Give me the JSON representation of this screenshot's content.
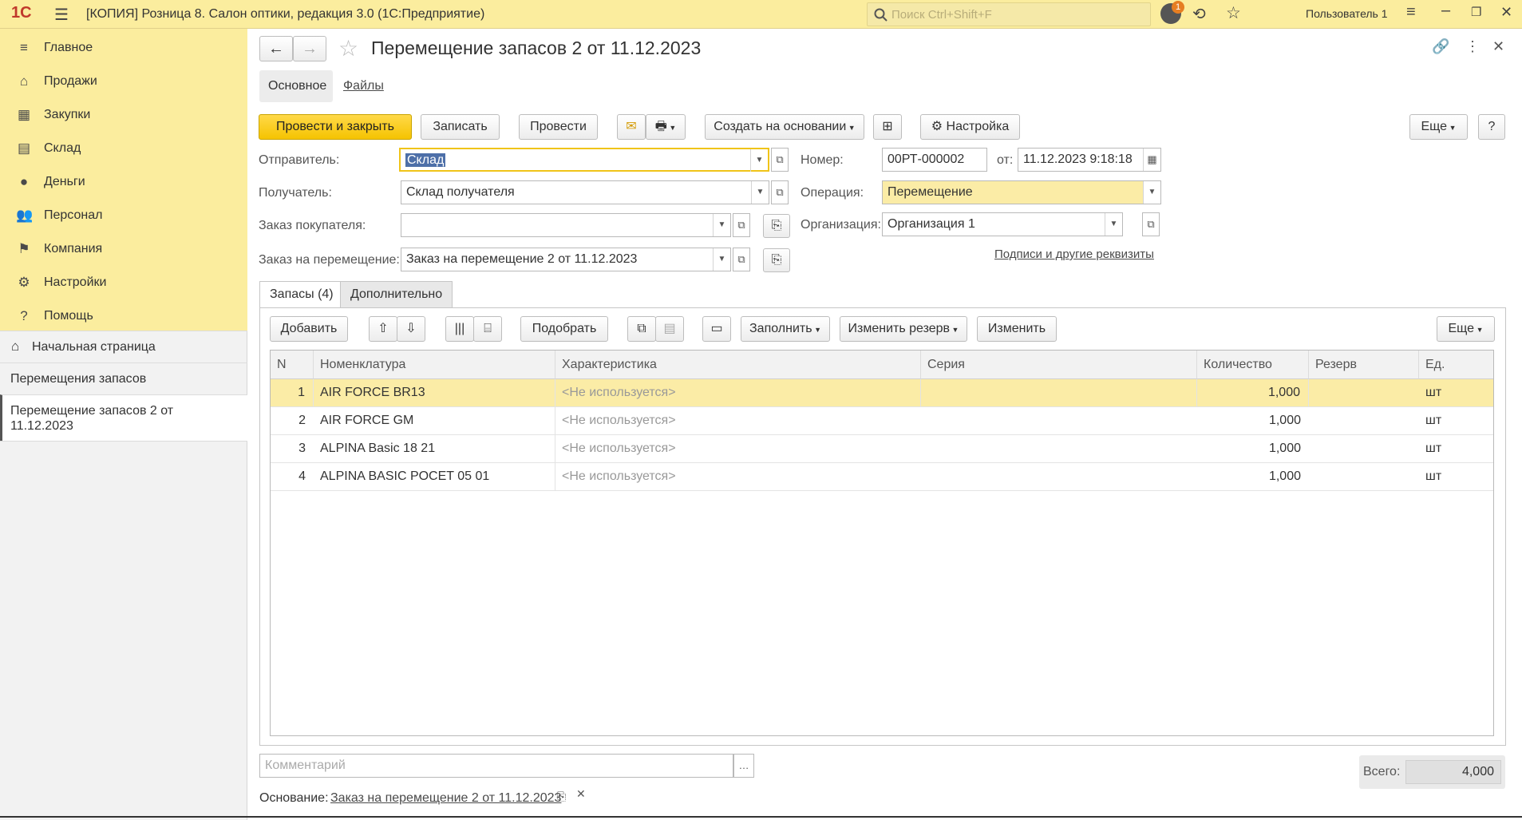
{
  "titlebar": {
    "logo": "1С",
    "title": "[КОПИЯ] Розница 8. Салон оптики, редакция 3.0  (1С:Предприятие)",
    "search_placeholder": "Поиск Ctrl+Shift+F",
    "notification_count": "1",
    "user": "Пользователь 1"
  },
  "sidebar": {
    "sections": [
      {
        "label": "Главное",
        "icon": "menu-icon"
      },
      {
        "label": "Продажи",
        "icon": "basket-icon"
      },
      {
        "label": "Закупки",
        "icon": "cart-icon"
      },
      {
        "label": "Склад",
        "icon": "warehouse-icon"
      },
      {
        "label": "Деньги",
        "icon": "money-icon"
      },
      {
        "label": "Персонал",
        "icon": "people-icon"
      },
      {
        "label": "Компания",
        "icon": "flag-icon"
      },
      {
        "label": "Настройки",
        "icon": "gear-icon"
      },
      {
        "label": "Помощь",
        "icon": "help-icon"
      }
    ],
    "home": "Начальная страница",
    "open_items": [
      "Перемещения запасов",
      "Перемещение запасов 2 от 11.12.2023"
    ]
  },
  "form": {
    "title": "Перемещение запасов 2 от 11.12.2023",
    "tabs_top": [
      "Основное",
      "Файлы"
    ],
    "toolbar": {
      "post_close": "Провести и закрыть",
      "save": "Записать",
      "post": "Провести",
      "create_based": "Создать на основании",
      "settings": "Настройка",
      "more": "Еще",
      "help": "?"
    },
    "fields": {
      "sender_label": "Отправитель:",
      "sender_value": "Склад",
      "receiver_label": "Получатель:",
      "receiver_value": "Склад получателя",
      "customer_order_label": "Заказ покупателя:",
      "customer_order_value": "",
      "transfer_order_label": "Заказ на перемещение:",
      "transfer_order_value": "Заказ на перемещение 2 от 11.12.2023",
      "number_label": "Номер:",
      "number_value": "00РТ-000002",
      "date_label": "от:",
      "date_value": "11.12.2023  9:18:18",
      "operation_label": "Операция:",
      "operation_value": "Перемещение",
      "org_label": "Организация:",
      "org_value": "Организация 1",
      "signatures_link": "Подписи и другие реквизиты"
    },
    "inner_tabs": [
      "Запасы (4)",
      "Дополнительно"
    ],
    "table_toolbar": {
      "add": "Добавить",
      "select": "Подобрать",
      "fill": "Заполнить",
      "change_reserve": "Изменить резерв",
      "change": "Изменить",
      "more": "Еще"
    },
    "table": {
      "columns": [
        "N",
        "Номенклатура",
        "Характеристика",
        "Серия",
        "Количество",
        "Резерв",
        "Ед."
      ],
      "rows": [
        {
          "n": "1",
          "item": "AIR FORCE BR13",
          "char": "<Не используется>",
          "series": "",
          "qty": "1,000",
          "reserve": "",
          "unit": "шт"
        },
        {
          "n": "2",
          "item": "AIR FORCE GM",
          "char": "<Не используется>",
          "series": "",
          "qty": "1,000",
          "reserve": "",
          "unit": "шт"
        },
        {
          "n": "3",
          "item": "ALPINA Basic 18 21",
          "char": "<Не используется>",
          "series": "",
          "qty": "1,000",
          "reserve": "",
          "unit": "шт"
        },
        {
          "n": "4",
          "item": "ALPINA BASIC POCET 05 01",
          "char": "<Не используется>",
          "series": "",
          "qty": "1,000",
          "reserve": "",
          "unit": "шт"
        }
      ]
    },
    "comment_placeholder": "Комментарий",
    "total_label": "Всего:",
    "total_value": "4,000",
    "basis_label": "Основание:",
    "basis_link": "Заказ на перемещение 2 от 11.12.2023"
  }
}
